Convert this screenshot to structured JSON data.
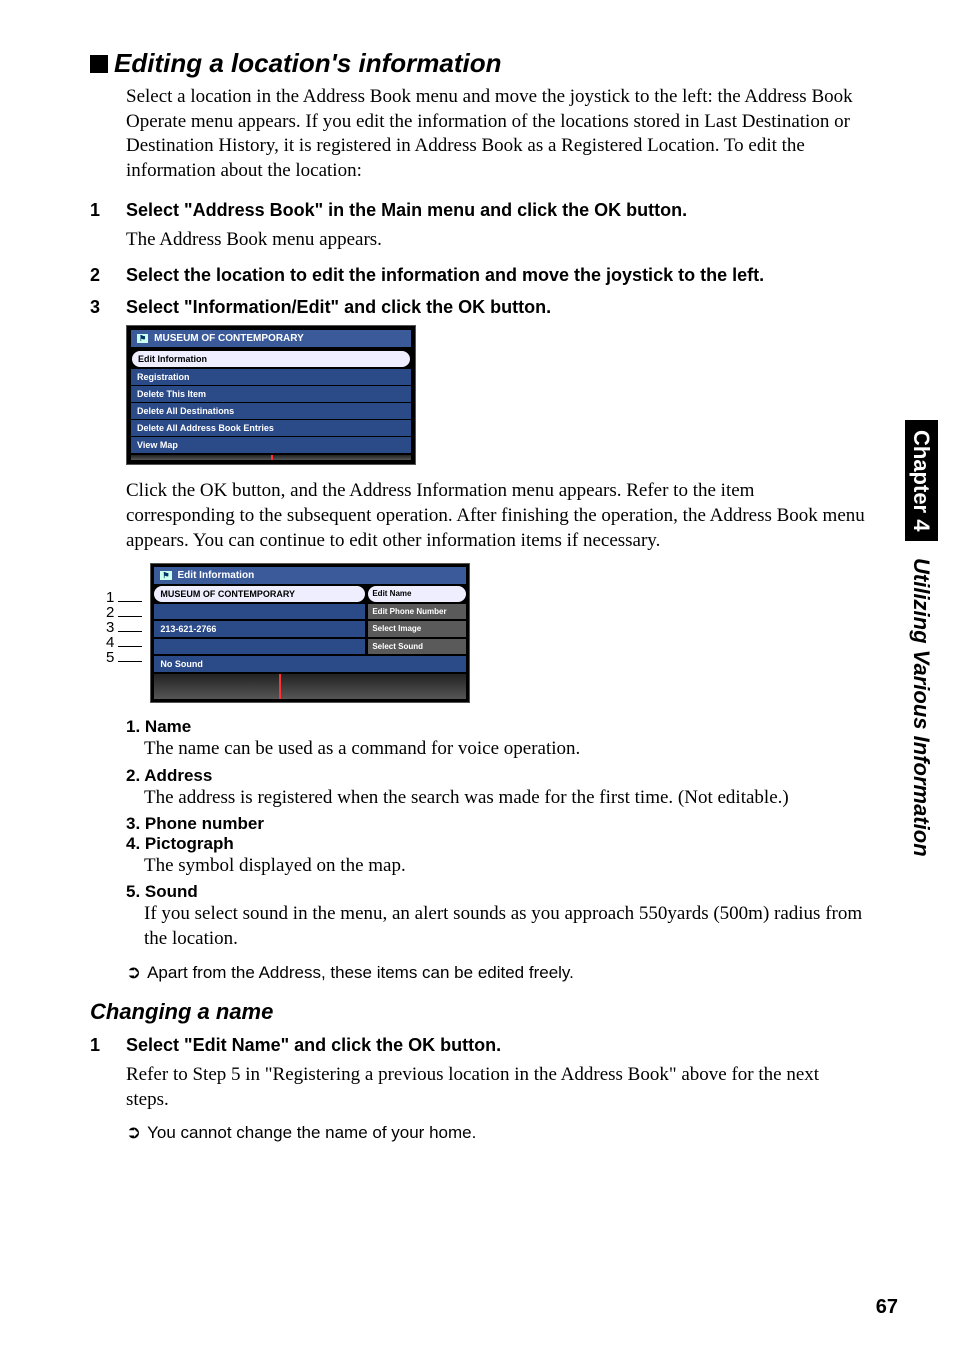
{
  "sideTab": {
    "chapter": "Chapter 4",
    "title": "Utilizing Various Information"
  },
  "h1": "Editing a location's information",
  "intro": "Select a location in the Address Book menu and move the joystick to the left: the Address Book Operate menu appears. If you edit the information of the locations stored in Last Destination or Destination History, it is registered in Address Book as a Registered Location. To edit the information about the location:",
  "steps": [
    {
      "n": "1",
      "title": "Select \"Address Book\" in the Main menu and click the OK button.",
      "body": "The Address Book menu appears."
    },
    {
      "n": "2",
      "title": "Select the location to edit the information and move the joystick to the left."
    },
    {
      "n": "3",
      "title": "Select \"Information/Edit\" and click the OK button."
    }
  ],
  "shotA": {
    "title": "MUSEUM OF CONTEMPORARY",
    "items": [
      "Edit Information",
      "Registration",
      "Delete This Item",
      "Delete All Destinations",
      "Delete All Address Book Entries",
      "View Map"
    ]
  },
  "afterShotA": "Click the OK button, and the Address Information menu appears. Refer to the item corresponding to the subsequent operation. After finishing the operation, the Address Book menu appears. You can continue to edit other information items if necessary.",
  "shotB": {
    "title": "Edit Information",
    "left": [
      "MUSEUM OF CONTEMPORARY",
      "",
      "213-621-2766",
      "",
      "No Sound"
    ],
    "right": [
      "Edit Name",
      "Edit Phone Number",
      "Select Image",
      "Select Sound"
    ],
    "callouts": [
      "1",
      "2",
      "3",
      "4",
      "5"
    ]
  },
  "defs": [
    {
      "n": "1.",
      "t": "Name",
      "d": "The name can be used as a command for voice operation."
    },
    {
      "n": "2.",
      "t": "Address",
      "d": "The address is registered when the search was made for the first time. (Not editable.)"
    },
    {
      "n": "3.",
      "t": "Phone number",
      "d": ""
    },
    {
      "n": "4.",
      "t": "Pictograph",
      "d": "The symbol displayed on the map."
    },
    {
      "n": "5.",
      "t": "Sound",
      "d": "If you select sound in the menu, an alert sounds as you approach 550yards (500m) radius from the location."
    }
  ],
  "note1": "Apart from the Address, these items can be edited freely.",
  "h2": "Changing a name",
  "h2step": {
    "n": "1",
    "title": "Select \"Edit Name\" and click the OK button.",
    "body": "Refer to Step 5 in \"Registering a previous location in the Address Book\" above for the next steps."
  },
  "note2": "You cannot change the name of your home.",
  "pageNum": "67"
}
